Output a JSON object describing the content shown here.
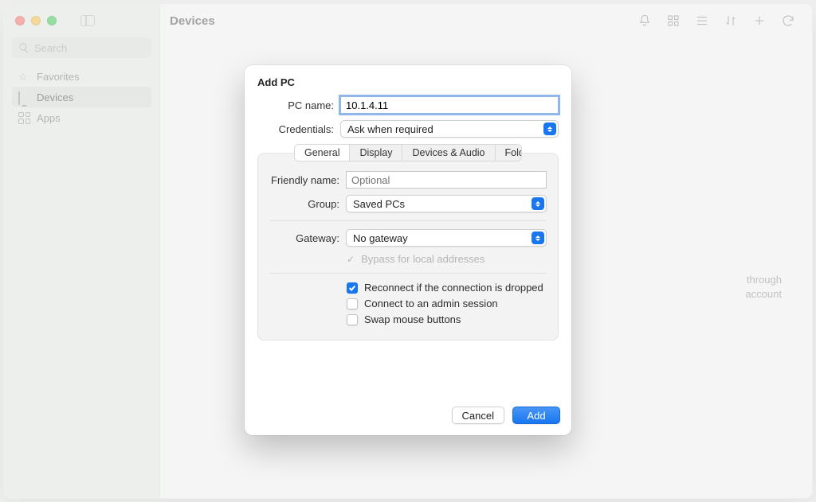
{
  "sidebar": {
    "search_placeholder": "Search",
    "items": [
      {
        "label": "Favorites",
        "icon": "star"
      },
      {
        "label": "Devices",
        "icon": "monitor",
        "selected": true
      },
      {
        "label": "Apps",
        "icon": "grid"
      }
    ]
  },
  "header": {
    "title": "Devices"
  },
  "background_hint": {
    "line1": "through",
    "line2": "account"
  },
  "modal": {
    "title": "Add PC",
    "pc_name": {
      "label": "PC name:",
      "value": "10.1.4.11"
    },
    "credentials": {
      "label": "Credentials:",
      "value": "Ask when required"
    },
    "tabs": [
      "General",
      "Display",
      "Devices & Audio",
      "Folders"
    ],
    "active_tab": "General",
    "friendly_name": {
      "label": "Friendly name:",
      "placeholder": "Optional",
      "value": ""
    },
    "group": {
      "label": "Group:",
      "value": "Saved PCs"
    },
    "gateway": {
      "label": "Gateway:",
      "value": "No gateway"
    },
    "bypass_local": {
      "label": "Bypass for local addresses",
      "checked": true,
      "disabled": true
    },
    "checkboxes": [
      {
        "label": "Reconnect if the connection is dropped",
        "checked": true
      },
      {
        "label": "Connect to an admin session",
        "checked": false
      },
      {
        "label": "Swap mouse buttons",
        "checked": false
      }
    ],
    "buttons": {
      "cancel": "Cancel",
      "confirm": "Add"
    }
  }
}
